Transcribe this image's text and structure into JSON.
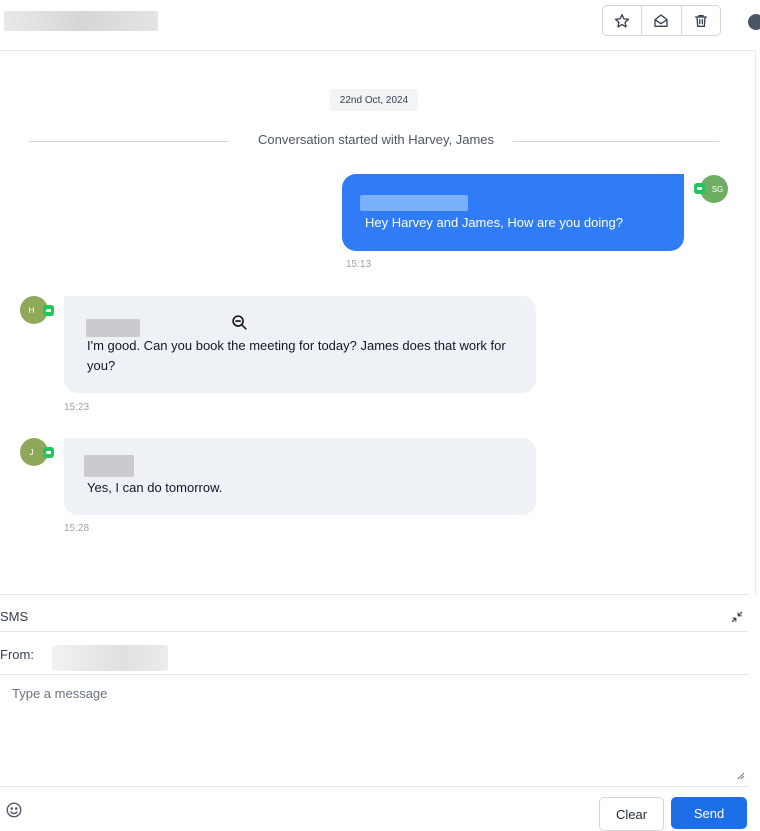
{
  "header": {
    "actions": [
      {
        "name": "star",
        "icon": "star-icon"
      },
      {
        "name": "mark-read",
        "icon": "envelope-open-icon"
      },
      {
        "name": "delete",
        "icon": "trash-icon"
      }
    ]
  },
  "conversation": {
    "date_chip": "22nd Oct, 2024",
    "started_text": "Conversation started with Harvey, James",
    "messages": [
      {
        "direction": "outbound",
        "avatar": "SG",
        "text": "Hey Harvey and James, How are you doing?",
        "time": "15:13"
      },
      {
        "direction": "inbound",
        "avatar": "H",
        "text": "I'm good. Can you book the meeting for today? James does that work for you?",
        "time": "15:23"
      },
      {
        "direction": "inbound",
        "avatar": "J",
        "text": "Yes, I can do tomorrow.",
        "time": "15:28"
      }
    ]
  },
  "composer": {
    "channel": "SMS",
    "from_label": "From:",
    "placeholder": "Type a message",
    "clear_label": "Clear",
    "send_label": "Send"
  },
  "colors": {
    "outbound_bubble": "#2f7cf6",
    "inbound_bubble": "#eef1f6",
    "send_button": "#1d6fe8",
    "channel_badge": "#22c55e"
  }
}
